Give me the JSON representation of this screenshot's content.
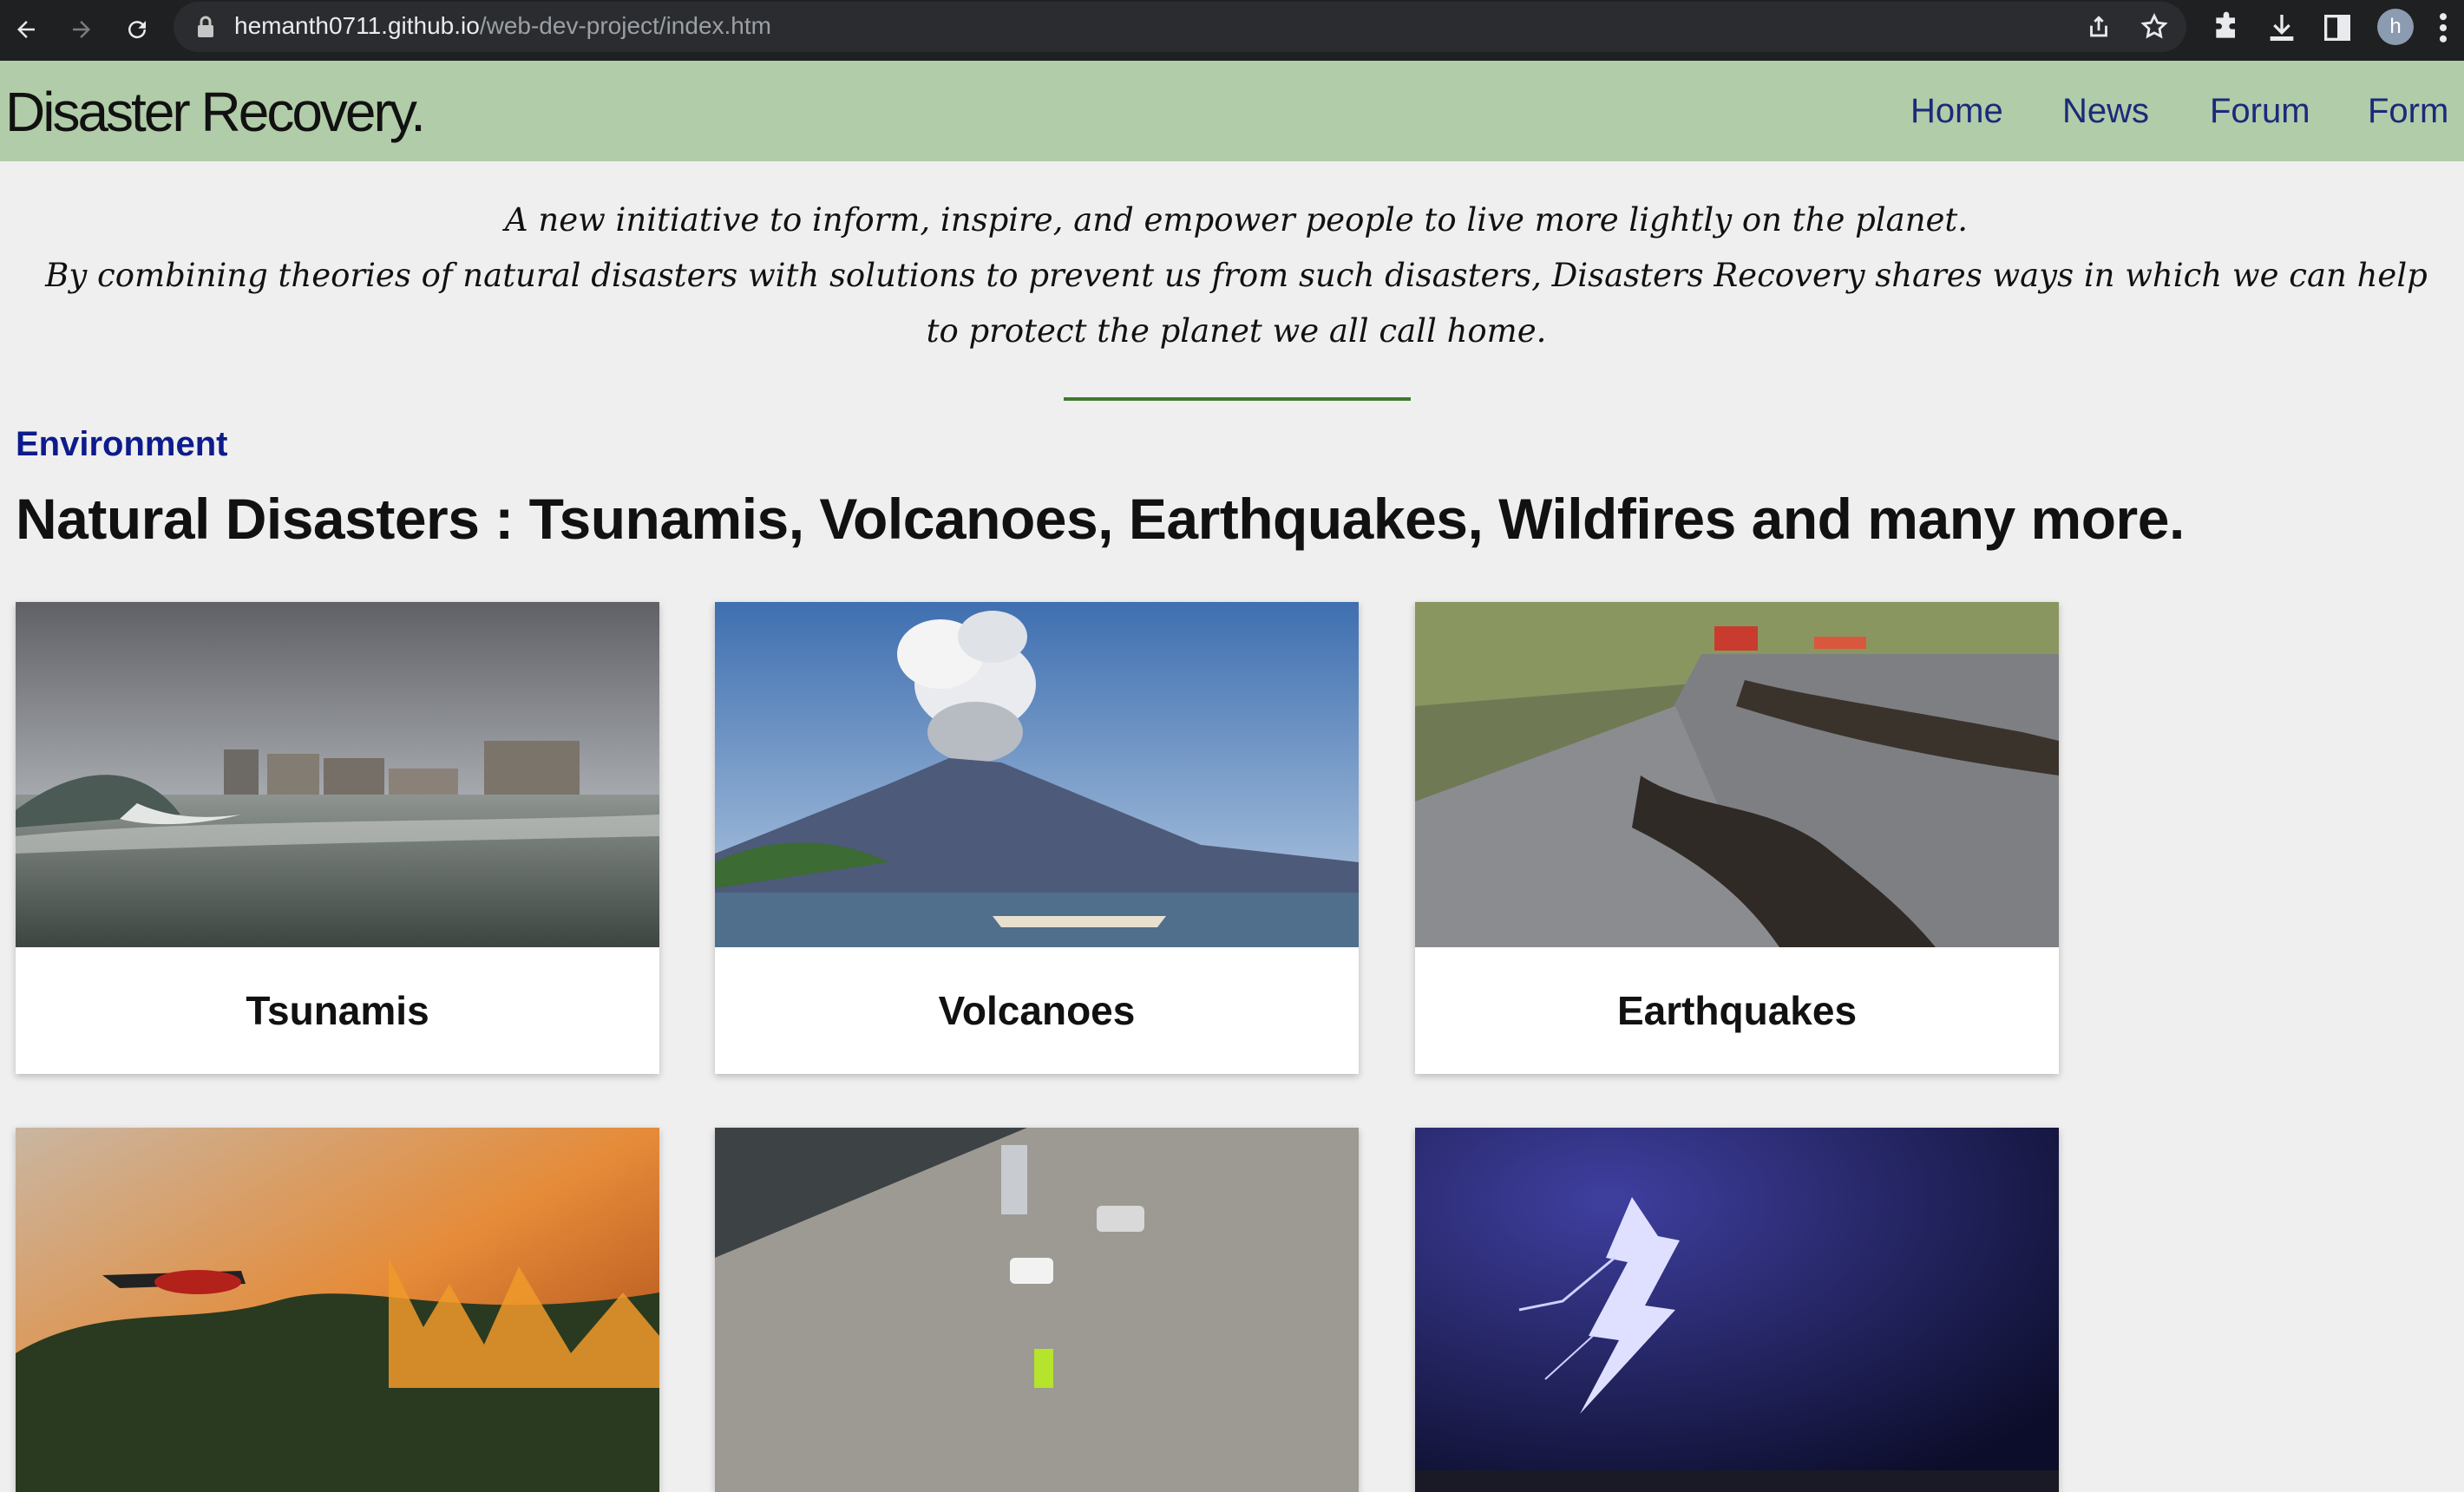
{
  "browser": {
    "url_host": "hemanth0711.github.io",
    "url_path": "/web-dev-project/index.htm",
    "avatar_letter": "h"
  },
  "site": {
    "brand": "Disaster Recovery.",
    "nav": [
      "Home",
      "News",
      "Forum",
      "Form"
    ],
    "colors": {
      "header": "#b1cca8",
      "nav_link": "#1b2a7a",
      "category": "#0d1b8c",
      "divider": "#3d7a2f"
    }
  },
  "intro": {
    "line1": "A new initiative to inform, inspire, and empower people to live more lightly on the planet.",
    "line2": "By combining theories of natural disasters with solutions to prevent us from such disasters, Disasters Recovery shares ways in which we can help to protect the planet we all call home."
  },
  "section": {
    "category": "Environment",
    "headline": "Natural Disasters : Tsunamis, Volcanoes, Earthquakes, Wildfires and many more."
  },
  "cards": [
    {
      "title": "Tsunamis"
    },
    {
      "title": "Volcanoes"
    },
    {
      "title": "Earthquakes"
    }
  ]
}
